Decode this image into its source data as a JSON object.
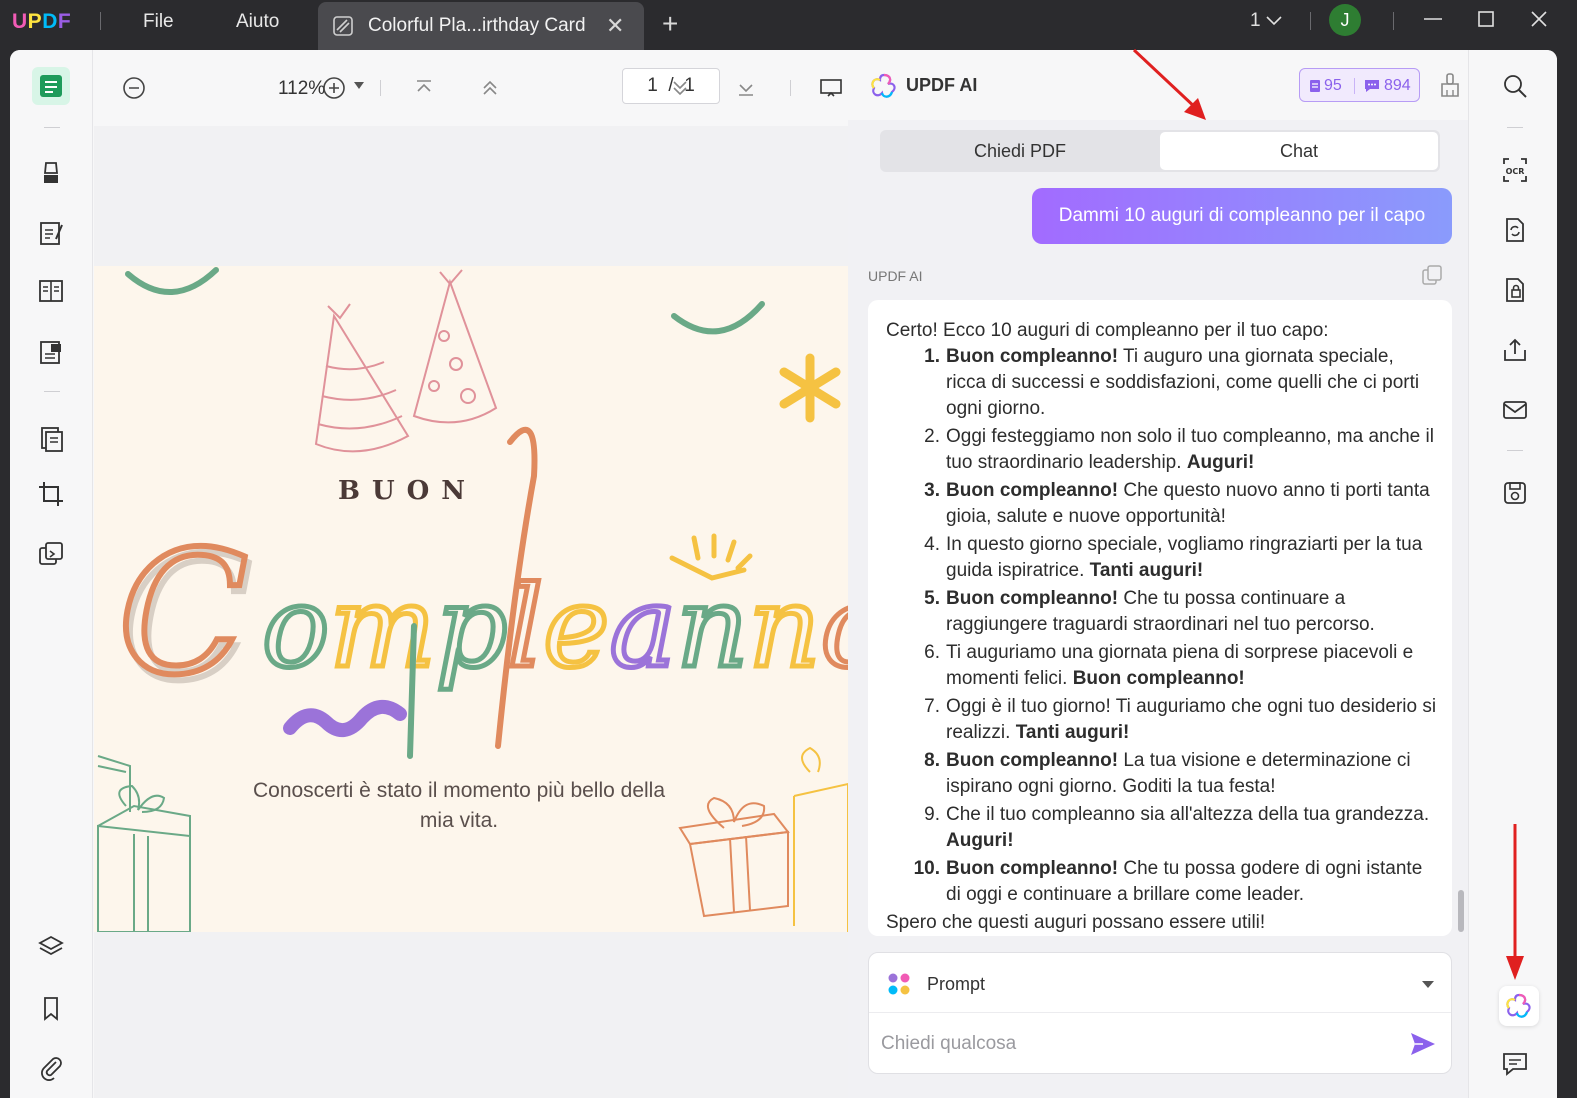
{
  "titlebar": {
    "logo": "UPDF",
    "menu": [
      "File",
      "Aiuto"
    ],
    "tab_title": "Colorful Pla...irthday Card",
    "window_count": "1",
    "avatar_letter": "J"
  },
  "toolbar": {
    "zoom": "112%",
    "page_current": "1",
    "page_sep": "/",
    "page_total": "1"
  },
  "card": {
    "buon": "BUON",
    "compleanno": "Compleanno",
    "subtitle": "Conoscerti è stato il momento più bello della mia vita."
  },
  "ai": {
    "title": "UPDF AI",
    "credits_docs": "95",
    "credits_chat": "894",
    "tabs": [
      "Chiedi PDF",
      "Chat"
    ],
    "active_tab": "Chat",
    "user_message": "Dammi 10 auguri di compleanno per il capo",
    "response_label": "UPDF AI",
    "response_intro": "Certo! Ecco 10 auguri di compleanno per il tuo capo:",
    "response_items": [
      {
        "num": "1.",
        "bold_num": true,
        "lead": "Buon compleanno!",
        "text": " Ti auguro una giornata speciale, ricca di successi e soddisfazioni, come quelli che ci porti ogni giorno.",
        "tail": ""
      },
      {
        "num": "2.",
        "bold_num": false,
        "lead": "",
        "text": "Oggi festeggiamo non solo il tuo compleanno, ma anche il tuo straordinario leadership. ",
        "tail": "Auguri!"
      },
      {
        "num": "3.",
        "bold_num": true,
        "lead": "Buon compleanno!",
        "text": " Che questo nuovo anno ti porti tanta gioia, salute e nuove opportunità!",
        "tail": ""
      },
      {
        "num": "4.",
        "bold_num": false,
        "lead": "",
        "text": "In questo giorno speciale, vogliamo ringraziarti per la tua guida ispiratrice. ",
        "tail": "Tanti auguri!"
      },
      {
        "num": "5.",
        "bold_num": true,
        "lead": "Buon compleanno!",
        "text": " Che tu possa continuare a raggiungere traguardi straordinari nel tuo percorso.",
        "tail": ""
      },
      {
        "num": "6.",
        "bold_num": false,
        "lead": "",
        "text": "Ti auguriamo una giornata piena di sorprese piacevoli e momenti felici. ",
        "tail": "Buon compleanno!"
      },
      {
        "num": "7.",
        "bold_num": false,
        "lead": "",
        "text": "Oggi è il tuo giorno! Ti auguriamo che ogni tuo desiderio si realizzi. ",
        "tail": "Tanti auguri!"
      },
      {
        "num": "8.",
        "bold_num": true,
        "lead": "Buon compleanno!",
        "text": " La tua visione e determinazione ci ispirano ogni giorno. Goditi la tua festa!",
        "tail": ""
      },
      {
        "num": "9.",
        "bold_num": false,
        "lead": "",
        "text": "Che il tuo compleanno sia all'altezza della tua grandezza. ",
        "tail": "Auguri!"
      },
      {
        "num": "10.",
        "bold_num": true,
        "lead": "Buon compleanno!",
        "text": " Che tu possa godere di ogni istante di oggi e continuare a brillare come leader.",
        "tail": ""
      }
    ],
    "response_outro": "Spero che questi auguri possano essere utili!",
    "prompt_label": "Prompt",
    "input_placeholder": "Chiedi qualcosa"
  },
  "colors": {
    "accent_purple": "#8b61ec",
    "active_green": "#d8f5e7",
    "annotation_red": "#e02020"
  },
  "icons": [
    "zoom-out-icon",
    "zoom-in-icon",
    "first-page-icon",
    "prev-page-icon",
    "next-page-icon",
    "last-page-icon",
    "presentation-icon",
    "search-icon",
    "ocr-icon",
    "convert-icon",
    "protect-icon",
    "share-icon",
    "mail-icon",
    "save-icon",
    "updf-ai-icon",
    "comment-icon",
    "layers-icon",
    "bookmark-icon",
    "attachment-icon"
  ]
}
